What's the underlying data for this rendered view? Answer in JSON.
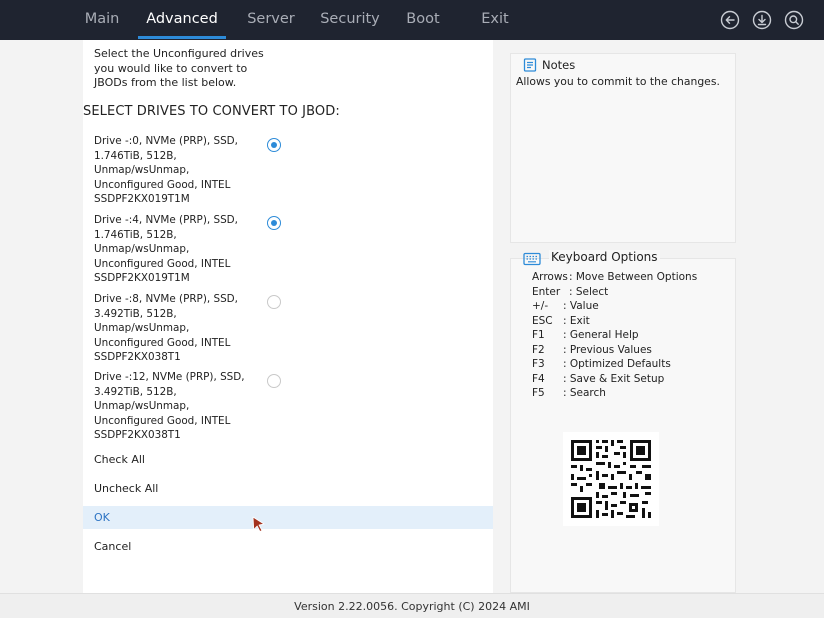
{
  "nav": {
    "tabs": [
      {
        "label": "Main"
      },
      {
        "label": "Advanced"
      },
      {
        "label": "Server"
      },
      {
        "label": "Security"
      },
      {
        "label": "Boot"
      },
      {
        "label": "Exit"
      }
    ],
    "active_tab": "Advanced",
    "icons": [
      "back-icon",
      "download-icon",
      "search-icon"
    ],
    "accent_color": "#2d8bd8"
  },
  "main": {
    "intro_lines": [
      "Select the Unconfigured drives",
      "you would like to convert to",
      "JBODs from the list below."
    ],
    "heading": "SELECT DRIVES TO CONVERT TO JBOD:",
    "drives": [
      {
        "lines": [
          "Drive -:0, NVMe (PRP), SSD,",
          "1.746TiB, 512B,",
          "Unmap/wsUnmap,",
          "Unconfigured Good, INTEL",
          "SSDPF2KX019T1M"
        ],
        "selected": true
      },
      {
        "lines": [
          "Drive -:4, NVMe (PRP), SSD,",
          "1.746TiB, 512B,",
          "Unmap/wsUnmap,",
          "Unconfigured Good, INTEL",
          "SSDPF2KX019T1M"
        ],
        "selected": true
      },
      {
        "lines": [
          "Drive -:8, NVMe (PRP), SSD,",
          "3.492TiB, 512B,",
          "Unmap/wsUnmap,",
          "Unconfigured Good, INTEL",
          "SSDPF2KX038T1"
        ],
        "selected": false
      },
      {
        "lines": [
          "Drive -:12, NVMe (PRP), SSD,",
          "3.492TiB, 512B,",
          "Unmap/wsUnmap,",
          "Unconfigured Good, INTEL",
          "SSDPF2KX038T1"
        ],
        "selected": false
      }
    ],
    "check_all": "Check All",
    "uncheck_all": "Uncheck All",
    "ok": "OK",
    "cancel": "Cancel"
  },
  "notes": {
    "title": "Notes",
    "text": "Allows you to commit to the changes."
  },
  "keyboard": {
    "title": "Keyboard Options",
    "rows": [
      {
        "key": "Arrows",
        "desc": ": Move Between Options"
      },
      {
        "key": "Enter",
        "desc": ": Select"
      },
      {
        "key": "+/-",
        "desc": ": Value"
      },
      {
        "key": "ESC",
        "desc": ": Exit"
      },
      {
        "key": "F1",
        "desc": ": General Help"
      },
      {
        "key": "F2",
        "desc": ": Previous Values"
      },
      {
        "key": "F3",
        "desc": ": Optimized Defaults"
      },
      {
        "key": "F4",
        "desc": ": Save & Exit Setup"
      },
      {
        "key": "F5",
        "desc": ": Search"
      }
    ]
  },
  "footer": {
    "text": "Version 2.22.0056. Copyright (C) 2024 AMI"
  }
}
